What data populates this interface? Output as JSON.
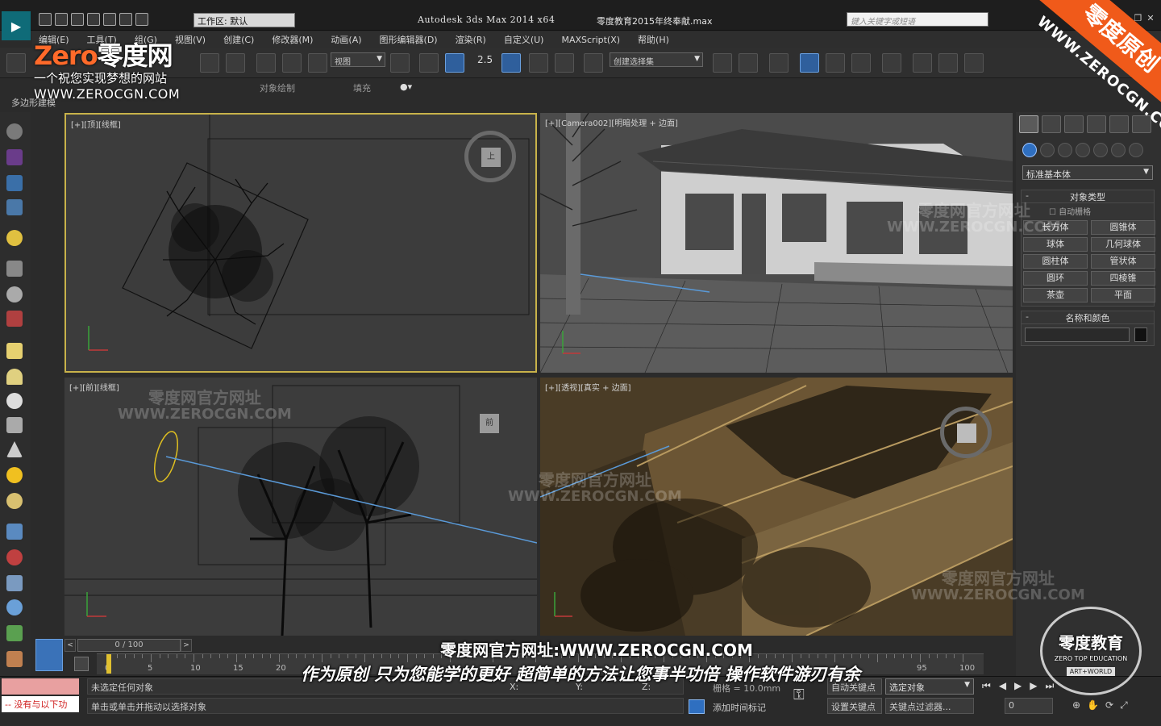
{
  "titlebar": {
    "workspace": "工作区: 默认",
    "app_title": "Autodesk 3ds Max  2014 x64",
    "file_title": "零度教育2015年终奉献.max",
    "search_placeholder": "键入关键字或短语"
  },
  "menu": {
    "items": [
      "编辑(E)",
      "工具(T)",
      "组(G)",
      "视图(V)",
      "创建(C)",
      "修改器(M)",
      "动画(A)",
      "图形编辑器(D)",
      "渲染(R)",
      "自定义(U)",
      "MAXScript(X)",
      "帮助(H)"
    ]
  },
  "toolbar": {
    "view_dropdown": "视图",
    "angle_snap": "2.5",
    "selection_set": "创建选择集"
  },
  "ribbon": {
    "tab_object_paint": "对象绘制",
    "tab_populate": "填充",
    "panel_label": "多边形建模"
  },
  "watermark": {
    "brand_zero": "Zero",
    "brand_cn": "零度网",
    "slogan": "一个祝您实现梦想的网站",
    "url": "WWW.ZEROCGN.COM",
    "corner_banner": "零度原创",
    "corner_url": "WWW.ZEROCGN.COM",
    "faint_title": "零度网官方网址",
    "faint_url": "WWW.ZEROCGN.COM"
  },
  "viewports": {
    "top_label": "[+][顶][线框]",
    "top_cube": "上",
    "camera_label": "[+][Camera002][明暗处理 + 边面]",
    "front_label": "[+][前][线框]",
    "front_cube": "前",
    "persp_label": "[+][透视][真实 + 边面]"
  },
  "command_panel": {
    "category": "标准基本体",
    "object_type_title": "对象类型",
    "auto_grid": "自动栅格",
    "buttons": [
      "长方体",
      "圆锥体",
      "球体",
      "几何球体",
      "圆柱体",
      "管状体",
      "圆环",
      "四棱锥",
      "茶壶",
      "平面"
    ],
    "name_color_title": "名称和颜色"
  },
  "timeline": {
    "frame": "0 / 100",
    "prev": "<",
    "next": ">",
    "ticks": [
      "0",
      "5",
      "10",
      "15",
      "20",
      "95",
      "100"
    ]
  },
  "captions": {
    "line1": "零度网官方网址:WWW.ZEROCGN.COM",
    "line2": "作为原创 只为您能学的更好 超简单的方法让您事半功倍 操作软件游刃有余"
  },
  "status": {
    "maxscript_text": "-- 没有与以下功",
    "selection": "未选定任何对象",
    "prompt": "单击或单击并拖动以选择对象",
    "x_label": "X:",
    "y_label": "Y:",
    "z_label": "Z:",
    "grid": "栅格 = 10.0mm",
    "auto_key": "自动关键点",
    "set_key": "设置关键点",
    "add_time_tag": "添加时间标记",
    "key_mode": "选定对象",
    "key_filters": "关键点过滤器...",
    "frame_field": "0"
  },
  "badge": {
    "title": "零度教育",
    "sub": "ZERO TOP EDUCATION",
    "tag": "ART+WORLD"
  },
  "colors": {
    "viewport_active_border": "#c8b24a",
    "accent_orange": "#f05a1a",
    "persp_tint": "#4d3f2a"
  }
}
